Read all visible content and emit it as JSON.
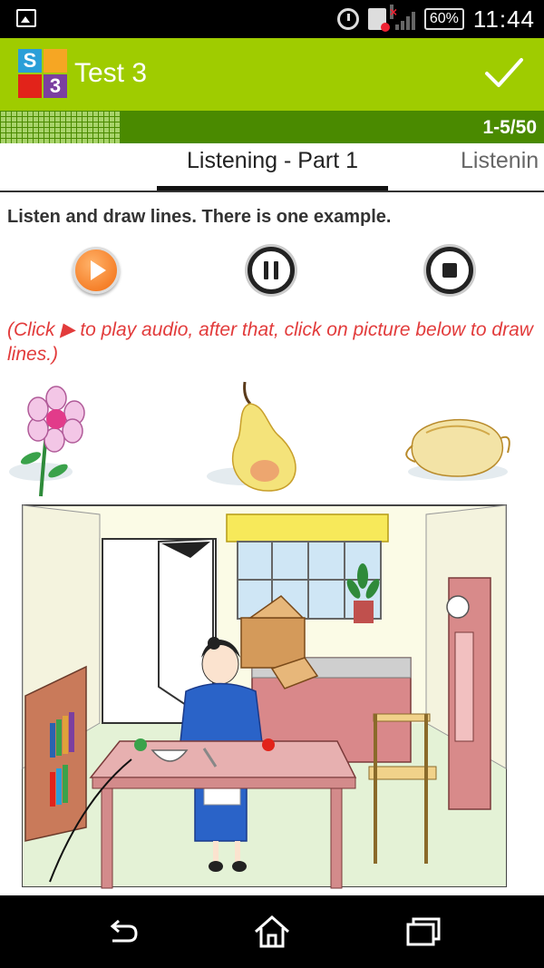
{
  "status_bar": {
    "battery": "60%",
    "time": "11:44"
  },
  "app_bar": {
    "logo_letter_top": "S",
    "logo_number_bottom": "3",
    "title": "Test 3"
  },
  "progress": {
    "count_text": "1-5/50"
  },
  "tabs": [
    {
      "label": "Listening - Part 1",
      "active": true
    },
    {
      "label": "Listenin",
      "active": false
    }
  ],
  "content": {
    "instruction": "Listen and draw lines. There is one example.",
    "note_before_icon": "(Click ",
    "note_after_icon": " to play audio, after that, click on picture below to draw lines.)"
  },
  "colors": {
    "app_bar": "#9fcc00",
    "progress_strip": "#4a8a00",
    "note_text": "#e23b3b",
    "play_button": "#f26b0f"
  }
}
